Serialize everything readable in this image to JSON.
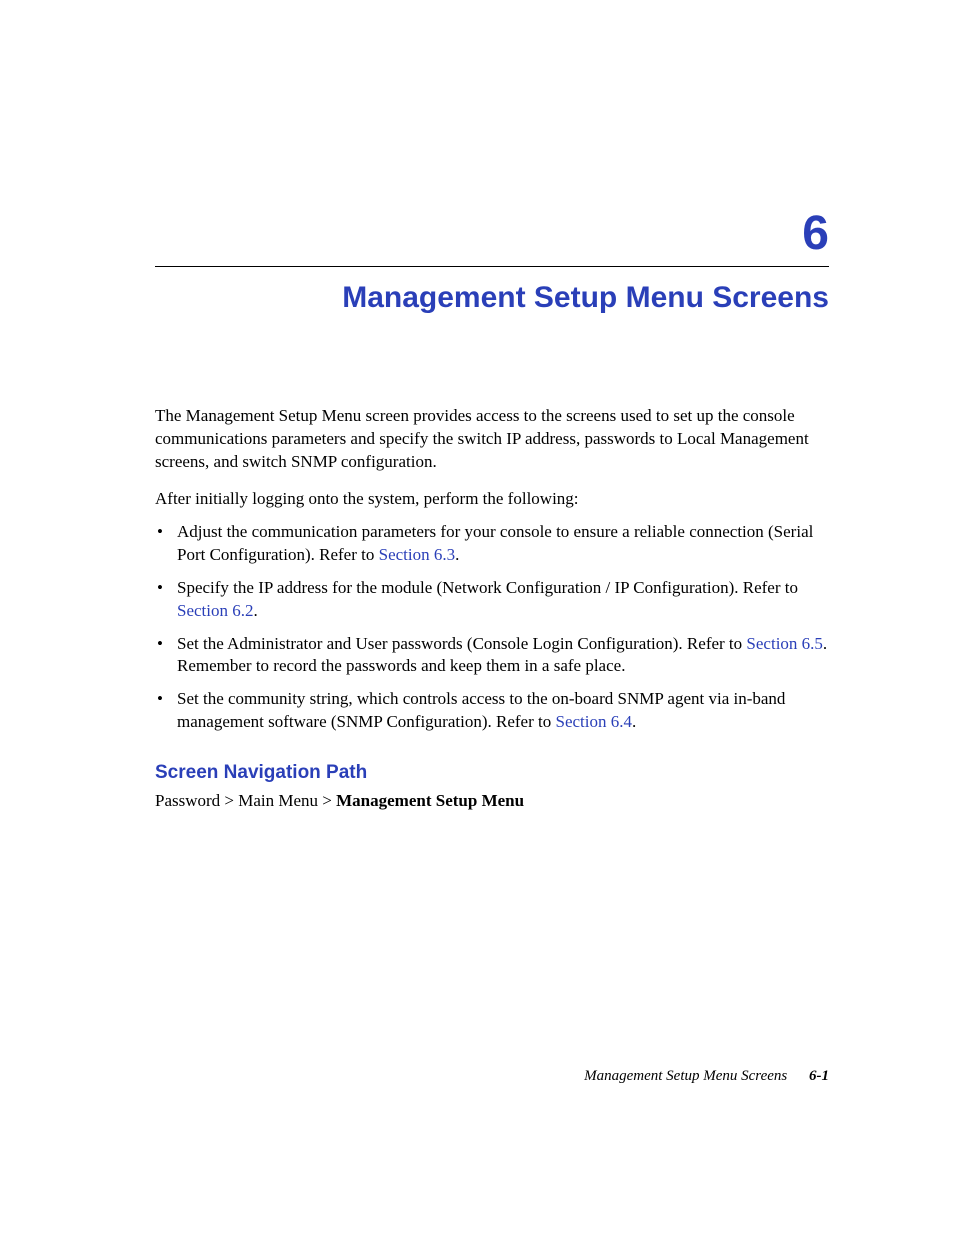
{
  "chapter": {
    "number": "6",
    "title": "Management Setup Menu Screens"
  },
  "intro": "The Management Setup Menu screen provides access to the screens used to set up the console communications parameters and specify the switch IP address, passwords to Local Management screens, and switch SNMP configuration.",
  "lead": "After initially logging onto the system, perform the following:",
  "bullets": [
    {
      "pre": "Adjust the communication parameters for your console to ensure a reliable connection (Serial Port Configuration). Refer to ",
      "link": "Section 6.3",
      "post": "."
    },
    {
      "pre": "Specify the IP address for the module (Network Configuration / IP Configuration). Refer to ",
      "link": "Section 6.2",
      "post": "."
    },
    {
      "pre": "Set the Administrator and User passwords (Console Login Configuration). Refer to ",
      "link": "Section 6.5",
      "post": ". Remember to record the passwords and keep them in a safe place."
    },
    {
      "pre": "Set the community string, which controls access to the on-board SNMP agent via in-band management software (SNMP Configuration). Refer to ",
      "link": "Section 6.4",
      "post": "."
    }
  ],
  "nav": {
    "heading": "Screen Navigation Path",
    "path_plain": "Password > Main Menu > ",
    "path_bold": "Management Setup Menu"
  },
  "footer": {
    "title": "Management Setup Menu Screens",
    "page": "6-1"
  }
}
